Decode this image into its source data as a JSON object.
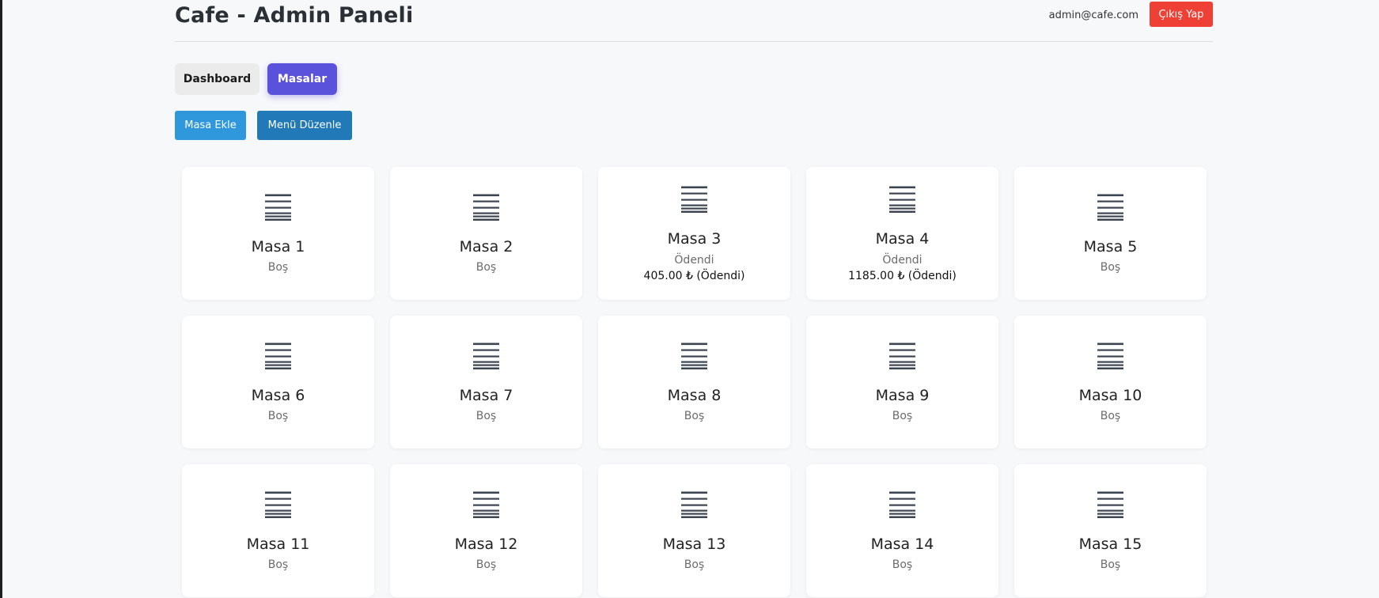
{
  "header": {
    "title": "Cafe - Admin Paneli",
    "user_email": "admin@cafe.com",
    "logout_label": "Çıkış Yap"
  },
  "nav": {
    "tabs": [
      {
        "label": "Dashboard",
        "active": false
      },
      {
        "label": "Masalar",
        "active": true
      }
    ]
  },
  "actions": {
    "add_table_label": "Masa Ekle",
    "edit_menu_label": "Menü Düzenle"
  },
  "colors": {
    "accent": "#5b52db",
    "logout": "#ee4035",
    "add_button": "#2f98dd",
    "menu_button": "#2179b8",
    "icon": "#3d4553"
  },
  "tables": [
    {
      "name": "Masa 1",
      "status": "Boş",
      "amount": ""
    },
    {
      "name": "Masa 2",
      "status": "Boş",
      "amount": ""
    },
    {
      "name": "Masa 3",
      "status": "Ödendi",
      "amount": "405.00 ₺ (Ödendi)"
    },
    {
      "name": "Masa 4",
      "status": "Ödendi",
      "amount": "1185.00 ₺ (Ödendi)"
    },
    {
      "name": "Masa 5",
      "status": "Boş",
      "amount": ""
    },
    {
      "name": "Masa 6",
      "status": "Boş",
      "amount": ""
    },
    {
      "name": "Masa 7",
      "status": "Boş",
      "amount": ""
    },
    {
      "name": "Masa 8",
      "status": "Boş",
      "amount": ""
    },
    {
      "name": "Masa 9",
      "status": "Boş",
      "amount": ""
    },
    {
      "name": "Masa 10",
      "status": "Boş",
      "amount": ""
    },
    {
      "name": "Masa 11",
      "status": "Boş",
      "amount": ""
    },
    {
      "name": "Masa 12",
      "status": "Boş",
      "amount": ""
    },
    {
      "name": "Masa 13",
      "status": "Boş",
      "amount": ""
    },
    {
      "name": "Masa 14",
      "status": "Boş",
      "amount": ""
    },
    {
      "name": "Masa 15",
      "status": "Boş",
      "amount": ""
    }
  ]
}
